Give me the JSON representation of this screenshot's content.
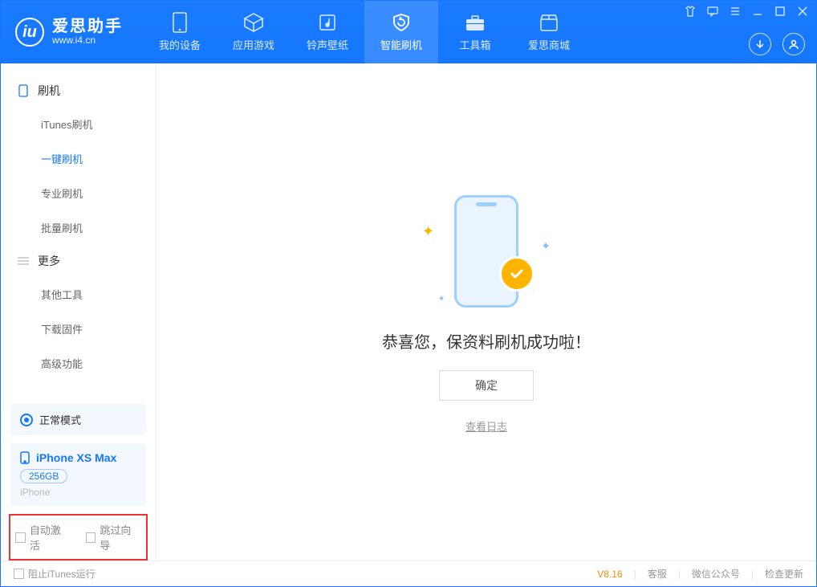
{
  "app": {
    "name": "爱思助手",
    "url": "www.i4.cn"
  },
  "tabs": [
    {
      "label": "我的设备"
    },
    {
      "label": "应用游戏"
    },
    {
      "label": "铃声壁纸"
    },
    {
      "label": "智能刷机"
    },
    {
      "label": "工具箱"
    },
    {
      "label": "爱思商城"
    }
  ],
  "sidebar": {
    "group1": {
      "title": "刷机",
      "items": [
        "iTunes刷机",
        "一键刷机",
        "专业刷机",
        "批量刷机"
      ]
    },
    "group2": {
      "title": "更多",
      "items": [
        "其他工具",
        "下载固件",
        "高级功能"
      ]
    }
  },
  "mode": {
    "label": "正常模式"
  },
  "device": {
    "name": "iPhone XS Max",
    "capacity": "256GB",
    "type": "iPhone"
  },
  "options": {
    "auto_activate": "自动激活",
    "skip_guide": "跳过向导"
  },
  "main": {
    "success_text": "恭喜您，保资料刷机成功啦！",
    "ok": "确定",
    "view_log": "查看日志"
  },
  "footer": {
    "block_itunes": "阻止iTunes运行",
    "version": "V8.16",
    "links": [
      "客服",
      "微信公众号",
      "检查更新"
    ]
  }
}
